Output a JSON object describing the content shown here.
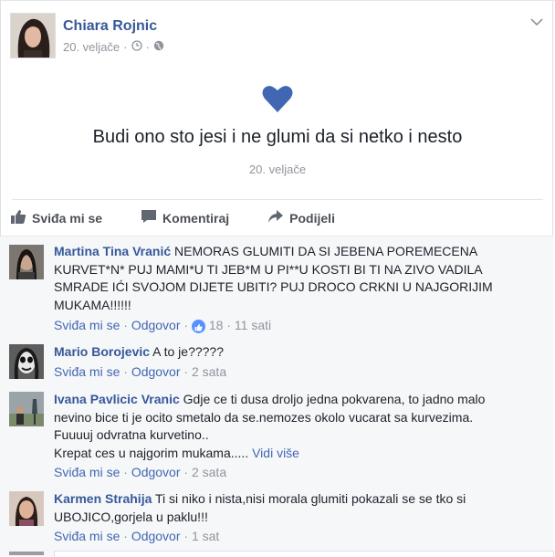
{
  "post": {
    "author": "Chiara Rojnic",
    "date": "20. veljače",
    "status_text": "Budi ono sto jesi i ne glumi da si netko i nesto",
    "status_date": "20. veljače",
    "heart_color": "#4267b2"
  },
  "actions": {
    "like": "Sviđa mi se",
    "comment": "Komentiraj",
    "share": "Podijeli"
  },
  "comments": [
    {
      "name": "Martina Tina Vranić",
      "text": " NEMORAS GLUMITI DA SI JEBENA POREMECENA KURVET*N* PUJ MAMI*U TI JEB*M U PI**U KOSTI BI TI NA ZIVO VADILA SMRADE IĆI SVOJOM DIJETE UBITI? PUJ DROCO CRKNI U NAJGORIJIM MUKAMA!!!!!!",
      "like": "Sviđa mi se",
      "reply": "Odgovor",
      "reactions": "18",
      "time": "11 sati"
    },
    {
      "name": "Mario Borojevic",
      "text": " A to je?????",
      "like": "Sviđa mi se",
      "reply": "Odgovor",
      "time": "2 sata"
    },
    {
      "name": "Ivana Pavlicic Vranic",
      "text": " Gdje ce ti dusa droljo jedna pokvarena, to jadno malo nevino bice ti je ocito smetalo da se.nemozes okolo vucarat sa kurvezima. Fuuuuj odvratna kurvetino..",
      "text2": "Krepat ces u najgorim mukama.....",
      "more": "Vidi više",
      "like": "Sviđa mi se",
      "reply": "Odgovor",
      "time": "2 sata"
    },
    {
      "name": "Karmen Strahija",
      "text": " Ti si niko i nista,nisi morala glumiti pokazali se se tko si UBOJICO,gorjela u paklu!!!",
      "like": "Sviđa mi se",
      "reply": "Odgovor",
      "time": "1 sat"
    }
  ],
  "separator": "·"
}
